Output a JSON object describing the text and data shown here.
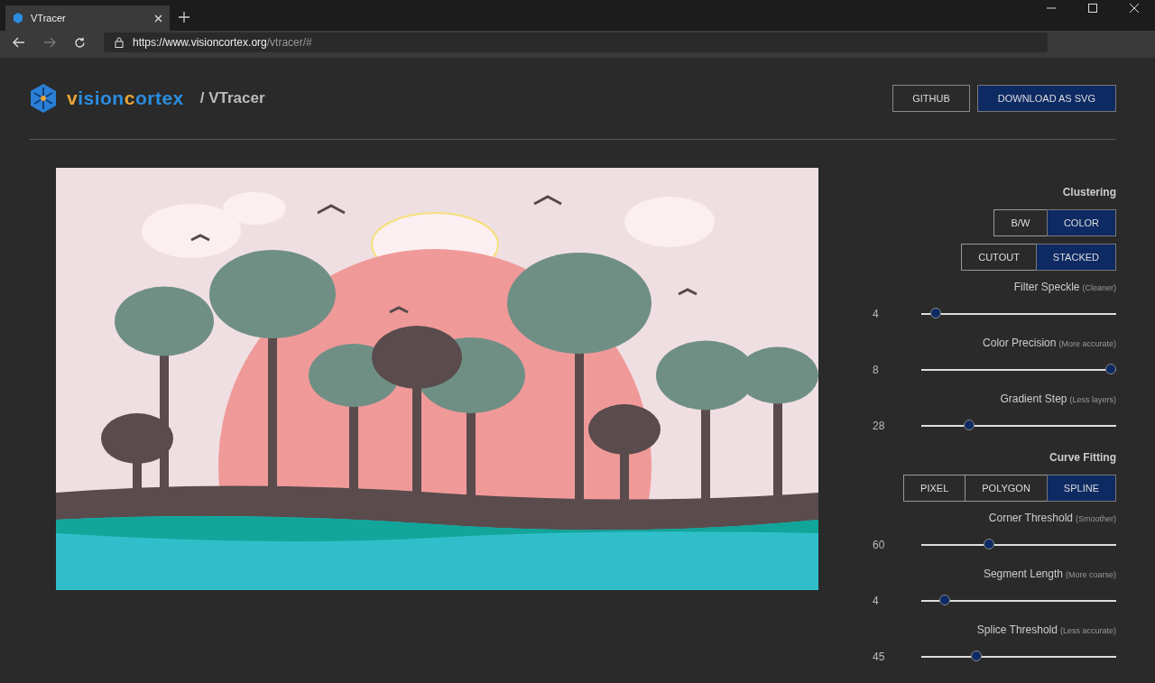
{
  "browser": {
    "tab_title": "VTracer",
    "url_host": "https://www.visioncortex.org",
    "url_path": "/vtracer/#"
  },
  "header": {
    "logo_parts": [
      {
        "text": "v",
        "accent": true
      },
      {
        "text": "ision",
        "accent": false
      },
      {
        "text": "c",
        "accent": true
      },
      {
        "text": "ortex",
        "accent": false
      }
    ],
    "title": "/ VTracer",
    "buttons": [
      {
        "label": "GITHUB",
        "primary": false
      },
      {
        "label": "DOWNLOAD AS SVG",
        "primary": true
      }
    ]
  },
  "controls": [
    {
      "kind": "heading",
      "text": "Clustering"
    },
    {
      "kind": "toggle",
      "options": [
        {
          "label": "B/W",
          "selected": false
        },
        {
          "label": "COLOR",
          "selected": true
        }
      ]
    },
    {
      "kind": "toggle",
      "options": [
        {
          "label": "CUTOUT",
          "selected": false
        },
        {
          "label": "STACKED",
          "selected": true
        }
      ]
    },
    {
      "kind": "slider",
      "label": "Filter Speckle",
      "hint": "(Cleaner)",
      "reading": "4",
      "level": 0.05
    },
    {
      "kind": "slider",
      "label": "Color Precision",
      "hint": "(More accurate)",
      "reading": "8",
      "level": 1.0
    },
    {
      "kind": "slider",
      "label": "Gradient Step",
      "hint": "(Less layers)",
      "reading": "28",
      "level": 0.23
    },
    {
      "kind": "heading",
      "text": "Curve Fitting"
    },
    {
      "kind": "toggle",
      "options": [
        {
          "label": "PIXEL",
          "selected": false
        },
        {
          "label": "POLYGON",
          "selected": false
        },
        {
          "label": "SPLINE",
          "selected": true
        }
      ]
    },
    {
      "kind": "slider",
      "label": "Corner Threshold",
      "hint": "(Smoother)",
      "reading": "60",
      "level": 0.34
    },
    {
      "kind": "slider",
      "label": "Segment Length",
      "hint": "(More coarse)",
      "reading": "4",
      "level": 0.1
    },
    {
      "kind": "slider",
      "label": "Splice Threshold",
      "hint": "(Less accurate)",
      "reading": "45",
      "level": 0.27
    }
  ]
}
